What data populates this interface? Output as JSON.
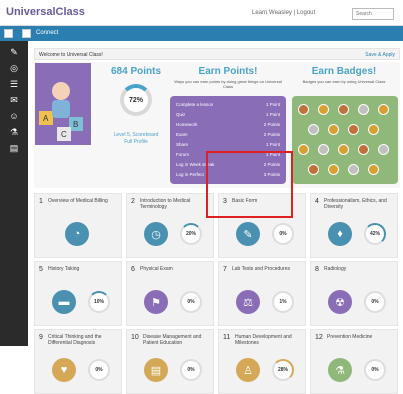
{
  "header": {
    "logo": "UniversalClass",
    "tagline": "",
    "top_links": "Learn Weasley | Logout",
    "search_placeholder": "Search"
  },
  "bluebar": {
    "label": "Connect"
  },
  "welcome": {
    "text": "Welcome to Universal Class!",
    "right_link": "Save & Apply"
  },
  "points": {
    "title": "684 Points",
    "ring_value": "72%",
    "level_text": "Level 5, Scoreboard\nFull Profile"
  },
  "earn_points": {
    "title": "Earn Points!",
    "subtitle": "Ways you can earn points by doing great things on Universal Class",
    "rows": [
      {
        "label": "Complete a lesson",
        "value": "1 Point"
      },
      {
        "label": "Quiz",
        "value": "1 Point"
      },
      {
        "label": "Homework",
        "value": "2 Points"
      },
      {
        "label": "Exam",
        "value": "2 Points"
      },
      {
        "label": "Share",
        "value": "1 Point"
      },
      {
        "label": "Forum",
        "value": "1 Point"
      },
      {
        "label": "Log in Week streak",
        "value": "2 Points"
      },
      {
        "label": "Log in Perfect",
        "value": "3 Points"
      }
    ]
  },
  "earn_badges": {
    "title": "Earn Badges!",
    "subtitle": "Badges you can earn by using Universal Class"
  },
  "courses": [
    {
      "num": "1",
      "title": "Overview of Medical Billing",
      "pct": "",
      "icon": "chart-icon",
      "color": "#4a90b0"
    },
    {
      "num": "2",
      "title": "Introduction to Medical Terminology",
      "pct": "20%",
      "icon": "clock-icon",
      "color": "#4a90b0"
    },
    {
      "num": "3",
      "title": "Basic Form",
      "pct": "0%",
      "icon": "edit-icon",
      "color": "#4a90b0"
    },
    {
      "num": "4",
      "title": "Professionalism, Ethics, and Diversity",
      "pct": "42%",
      "icon": "tie-icon",
      "color": "#4a90b0"
    },
    {
      "num": "5",
      "title": "History Taking",
      "pct": "10%",
      "icon": "folder-icon",
      "color": "#4a90b0"
    },
    {
      "num": "6",
      "title": "Physical Exam",
      "pct": "0%",
      "icon": "flag-icon",
      "color": "#8a6db7"
    },
    {
      "num": "7",
      "title": "Lab Tests and Procedures",
      "pct": "1%",
      "icon": "scale-icon",
      "color": "#8a6db7"
    },
    {
      "num": "8",
      "title": "Radiology",
      "pct": "0%",
      "icon": "radiation-icon",
      "color": "#8a6db7"
    },
    {
      "num": "9",
      "title": "Critical Thinking and the Differential Diagnosis",
      "pct": "0%",
      "icon": "heart-icon",
      "color": "#d4a857"
    },
    {
      "num": "10",
      "title": "Disease Management and Patient Education",
      "pct": "0%",
      "icon": "document-icon",
      "color": "#d4a857"
    },
    {
      "num": "11",
      "title": "Human Development and Milestones",
      "pct": "28%",
      "icon": "person-icon",
      "color": "#d4a857"
    },
    {
      "num": "12",
      "title": "Prevention Medicine",
      "pct": "0%",
      "icon": "vial-icon",
      "color": "#8fb87a"
    }
  ]
}
